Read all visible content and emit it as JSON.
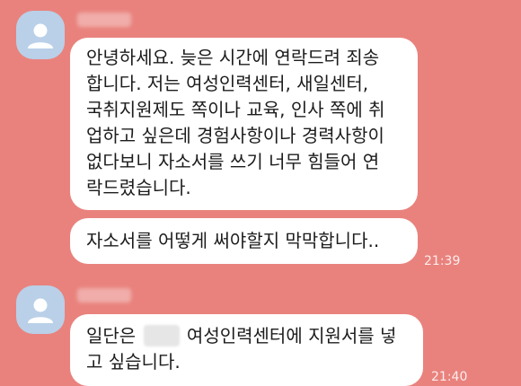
{
  "colors": {
    "background": "#e9827d",
    "bubble": "#ffffff",
    "avatar": "#b9d0e8"
  },
  "messages": [
    {
      "lines": [
        "안녕하세요. 늦은 시간에 연락드려 죄송",
        "합니다. 저는 여성인력센터, 새일센터,",
        "국취지원제도 쪽이나 교육, 인사 쪽에 취",
        "업하고 싶은데 경험사항이나 경력사항이",
        "없다보니 자소서를 쓰기 너무 힘들어 연",
        "락드렸습니다."
      ]
    },
    {
      "text": "자소서를 어떻게 써야할지 막막합니다..",
      "time": "21:39"
    },
    {
      "before": "일단은",
      "after": "여성인력센터에 지원서를 넣",
      "line2": "고 싶습니다.",
      "time": "21:40"
    }
  ]
}
